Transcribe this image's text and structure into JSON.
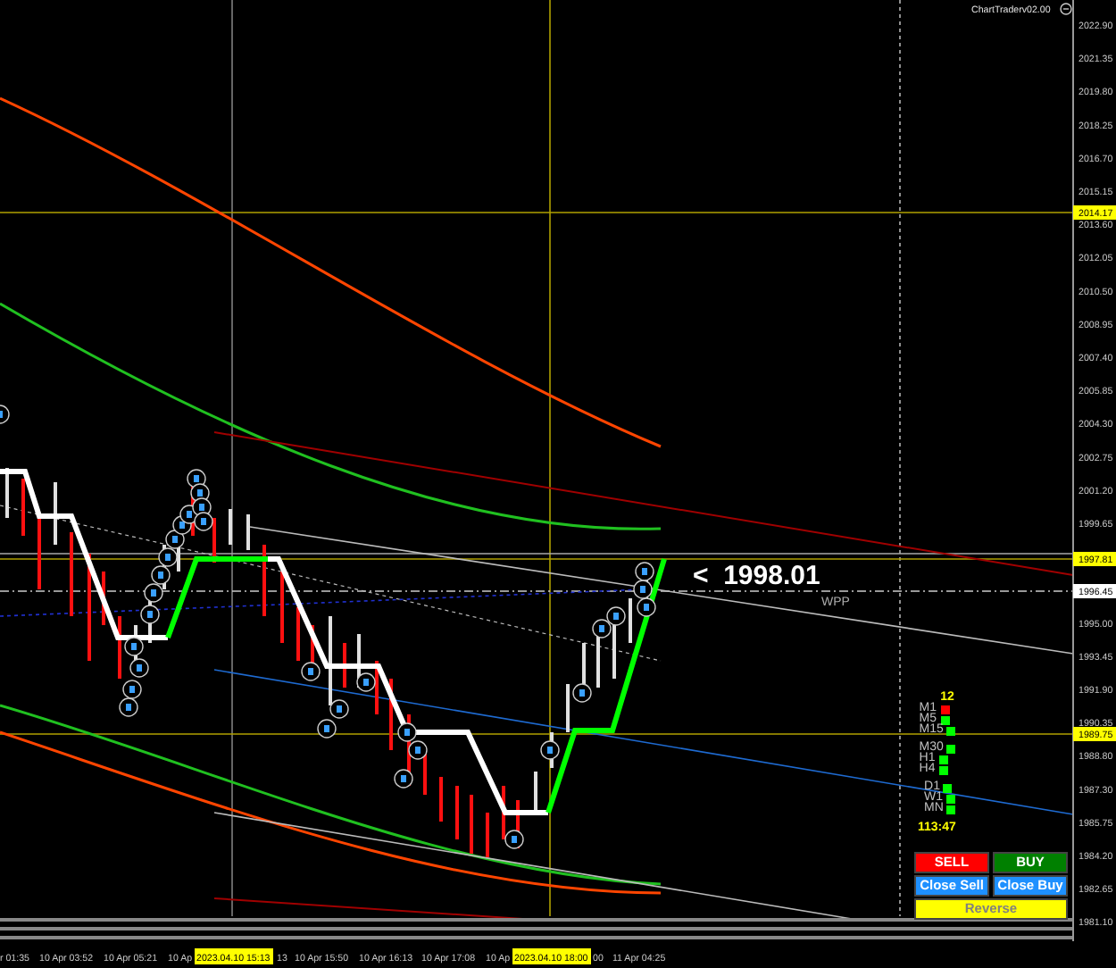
{
  "indicator_label": "ChartTraderv02.00",
  "price_callout": {
    "value": "<  1998.01",
    "label": "WPP"
  },
  "price_axis": {
    "labels": [
      "2022.90",
      "2021.35",
      "2019.80",
      "2018.25",
      "2016.70",
      "2015.15",
      "2013.60",
      "2012.05",
      "2010.50",
      "2008.95",
      "2007.40",
      "2005.85",
      "2004.30",
      "2002.75",
      "2001.20",
      "1999.65",
      "1995.00",
      "1993.45",
      "1991.90",
      "1990.35",
      "1988.80",
      "1987.30",
      "1985.75",
      "1984.20",
      "1982.65",
      "1981.10"
    ],
    "markers": [
      {
        "text": "2014.17",
        "kind": "line"
      },
      {
        "text": "1997.81",
        "kind": "line"
      },
      {
        "text": "1996.45",
        "kind": "bid"
      },
      {
        "text": "1989.75",
        "kind": "line"
      }
    ]
  },
  "time_axis": {
    "labels": [
      "r 01:35",
      "10 Apr 03:52",
      "10 Apr 05:21",
      "10 Ap",
      "13",
      "10 Apr 15:50",
      "10 Apr 16:13",
      "10 Apr 17:08",
      "10 Ap",
      "00",
      "11 Apr 04:25"
    ],
    "markers": [
      "2023.04.10 15:13",
      "2023.04.10 18:00"
    ]
  },
  "timeframes": {
    "count": "12",
    "groups": [
      {
        "rows": [
          {
            "label": "M1",
            "color": "#ff0000"
          },
          {
            "label": "M5",
            "color": "#00ff00"
          },
          {
            "label": "M15",
            "color": "#00ff00"
          }
        ]
      },
      {
        "rows": [
          {
            "label": "M30",
            "color": "#00ff00"
          },
          {
            "label": "H1",
            "color": "#00ff00"
          },
          {
            "label": "H4",
            "color": "#00ff00"
          }
        ]
      },
      {
        "rows": [
          {
            "label": "D1",
            "color": "#00ff00"
          },
          {
            "label": "W1",
            "color": "#00ff00"
          },
          {
            "label": "MN",
            "color": "#00ff00"
          }
        ]
      }
    ],
    "timer": "113:47"
  },
  "buttons": [
    {
      "label": "SELL",
      "kind": "sell"
    },
    {
      "label": "BUY",
      "kind": "buy"
    },
    {
      "label": "Close Sell",
      "kind": "close"
    },
    {
      "label": "Close Buy",
      "kind": "close"
    },
    {
      "label": "Reverse",
      "kind": "reverse"
    }
  ]
}
